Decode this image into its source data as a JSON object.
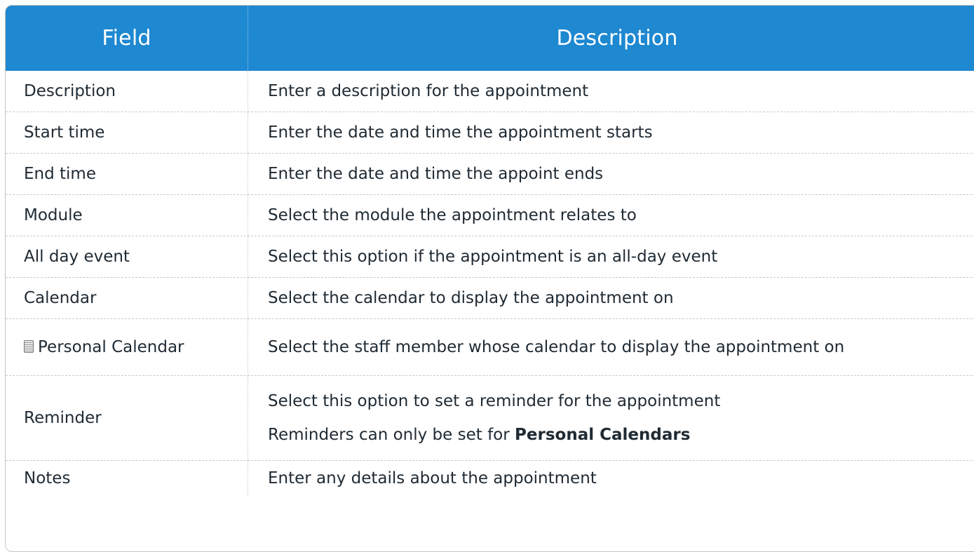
{
  "header": {
    "field_label": "Field",
    "description_label": "Description"
  },
  "rows": [
    {
      "field": "Description",
      "description": [
        "Enter a description for the appointment"
      ]
    },
    {
      "field": "Start time",
      "description": [
        "Enter the date and time the appointment starts"
      ]
    },
    {
      "field": "End time",
      "description": [
        "Enter the date and time the appoint ends"
      ]
    },
    {
      "field": "Module",
      "description": [
        "Select the module the appointment relates to"
      ]
    },
    {
      "field": "All day event",
      "description": [
        "Select this option if the appointment is an all-day event"
      ]
    },
    {
      "field": "Calendar",
      "description": [
        "Select the calendar to display the appointment on"
      ]
    },
    {
      "field": "Personal Calendar",
      "icon": "document-icon",
      "description": [
        "Select the staff member whose calendar to display the appointment on"
      ]
    },
    {
      "field": "Reminder",
      "description": [
        "Select this option to set a reminder for the appointment",
        "Reminders can only be set for "
      ],
      "bold": "Personal Calendars"
    },
    {
      "field": "Notes",
      "description": [
        "Enter any details about the appointment"
      ]
    }
  ],
  "colors": {
    "header_bg": "#1e88d1",
    "header_text": "#ffffff",
    "body_text": "#1f2a33",
    "border": "#c4c4c4"
  }
}
